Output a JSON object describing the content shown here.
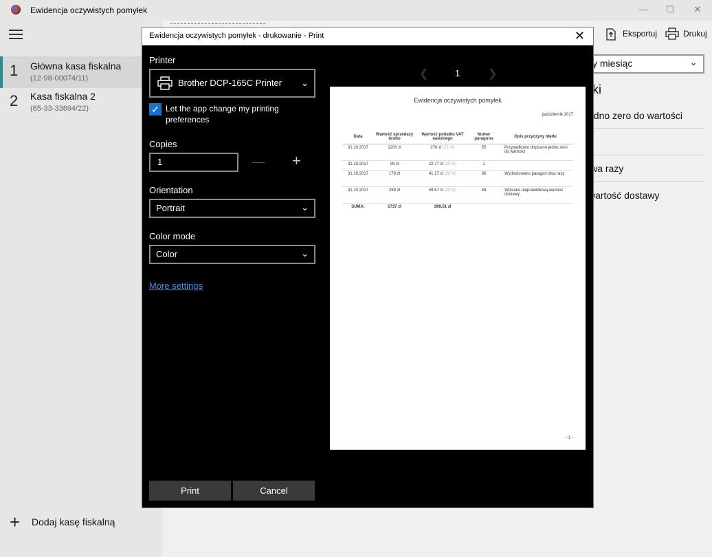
{
  "app": {
    "title": "Ewidencja oczywistych pomyłek",
    "window_controls": {
      "minimize": "—",
      "maximize": "☐",
      "close": "✕"
    }
  },
  "sidebar": {
    "registers": [
      {
        "number": "1",
        "name": "Główna kasa fiskalna",
        "code": "(12-98-00074/11)",
        "selected": true
      },
      {
        "number": "2",
        "name": "Kasa fiskalna 2",
        "code": "(65-33-33694/22)",
        "selected": false
      }
    ],
    "add_register_label": "Dodaj kasę fiskalną"
  },
  "toolbar": {
    "export_label": "Eksportuj",
    "print_label": "Drukuj"
  },
  "filters": {
    "period_value": "y miesiąc"
  },
  "side_panel": {
    "heading": "ki",
    "rows": [
      "edno zero do wartości",
      "",
      "lwa razy",
      "wartość dostawy"
    ]
  },
  "print_dialog": {
    "title": "Ewidencja oczywistych pomyłek - drukowanie - Print",
    "printer_label": "Printer",
    "printer_name": "Brother DCP-165C Printer",
    "allow_app_prefs_label": "Let the app change my printing preferences",
    "allow_app_prefs_checked": true,
    "copies_label": "Copies",
    "copies_value": "1",
    "orientation_label": "Orientation",
    "orientation_value": "Portrait",
    "color_mode_label": "Color mode",
    "color_mode_value": "Color",
    "more_settings_label": "More settings",
    "print_button": "Print",
    "cancel_button": "Cancel",
    "current_page": "1"
  },
  "preview": {
    "title": "Ewidencja oczywistych pomyłek",
    "month": "październik 2017",
    "columns": [
      "Data",
      "Wartość sprzedaży brutto",
      "Wartość podatku VAT należnego",
      "Numer paragonu",
      "Opis przyczyny błędu"
    ],
    "rows": [
      {
        "date": "31.10.2017",
        "gross": "1200 zł",
        "vat": "276 zł",
        "rate": "(23 %)",
        "receipt": "55",
        "desc": "Przypadkowo dopisano jedno zero do wartości"
      },
      {
        "date": "31.10.2017",
        "gross": "99 zł",
        "vat": "22.77 zł",
        "rate": "(23 %)",
        "receipt": "1",
        "desc": ""
      },
      {
        "date": "31.10.2017",
        "gross": "179 zł",
        "vat": "41.17 zł",
        "rate": "(23 %)",
        "receipt": "36",
        "desc": "Wydrukowano paragon dwa razy"
      },
      {
        "date": "31.10.2017",
        "gross": "259 zł",
        "vat": "59.57 zł",
        "rate": "(23 %)",
        "receipt": "48",
        "desc": "Wpisano nieprawidłową wartość dostawy"
      }
    ],
    "sum_label": "SUMA:",
    "sum_gross": "1737 zł",
    "sum_vat": "399,51 zł",
    "page_footer": "- 1 -"
  }
}
